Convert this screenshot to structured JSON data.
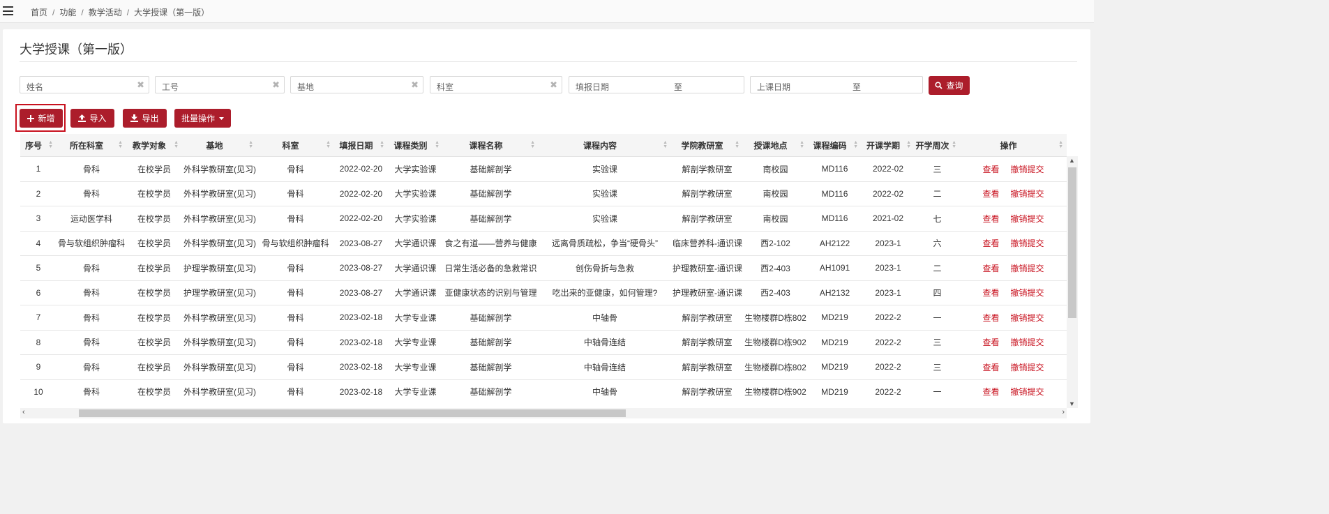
{
  "breadcrumb": [
    "首页",
    "功能",
    "教学活动",
    "大学授课（第一版）"
  ],
  "page": {
    "title": "大学授课（第一版）"
  },
  "filters": {
    "name_ph": "姓名",
    "id_ph": "工号",
    "base_ph": "基地",
    "dept_ph": "科室",
    "fill_date_ph": "填报日期",
    "class_date_ph": "上课日期",
    "to_text": "至",
    "clear_glyph": "✖",
    "search_label": "查询"
  },
  "toolbar": {
    "add_label": "新增",
    "import_label": "导入",
    "export_label": "导出",
    "batch_label": "批量操作"
  },
  "table": {
    "columns": [
      "序号",
      "所在科室",
      "教学对象",
      "基地",
      "科室",
      "填报日期",
      "课程类别",
      "课程名称",
      "课程内容",
      "学院教研室",
      "授课地点",
      "课程编码",
      "开课学期",
      "开学周次",
      "操作"
    ],
    "rows": [
      [
        "1",
        "骨科",
        "在校学员",
        "外科学教研室(见习)",
        "骨科",
        "2022-02-20",
        "大学实验课",
        "基础解剖学",
        "实验课",
        "解剖学教研室",
        "南校园",
        "MD116",
        "2022-02",
        "三"
      ],
      [
        "2",
        "骨科",
        "在校学员",
        "外科学教研室(见习)",
        "骨科",
        "2022-02-20",
        "大学实验课",
        "基础解剖学",
        "实验课",
        "解剖学教研室",
        "南校园",
        "MD116",
        "2022-02",
        "二"
      ],
      [
        "3",
        "运动医学科",
        "在校学员",
        "外科学教研室(见习)",
        "骨科",
        "2022-02-20",
        "大学实验课",
        "基础解剖学",
        "实验课",
        "解剖学教研室",
        "南校园",
        "MD116",
        "2021-02",
        "七"
      ],
      [
        "4",
        "骨与软组织肿瘤科",
        "在校学员",
        "外科学教研室(见习)",
        "骨与软组织肿瘤科",
        "2023-08-27",
        "大学通识课",
        "食之有道——营养与健康",
        "远离骨质疏松，争当“硬骨头”",
        "临床营养科-通识课",
        "西2-102",
        "AH2122",
        "2023-1",
        "六"
      ],
      [
        "5",
        "骨科",
        "在校学员",
        "护理学教研室(见习)",
        "骨科",
        "2023-08-27",
        "大学通识课",
        "日常生活必备的急救常识",
        "创伤骨折与急救",
        "护理教研室-通识课",
        "西2-403",
        "AH1091",
        "2023-1",
        "二"
      ],
      [
        "6",
        "骨科",
        "在校学员",
        "护理学教研室(见习)",
        "骨科",
        "2023-08-27",
        "大学通识课",
        "亚健康状态的识别与管理",
        "吃出来的亚健康，如何管理?",
        "护理教研室-通识课",
        "西2-403",
        "AH2132",
        "2023-1",
        "四"
      ],
      [
        "7",
        "骨科",
        "在校学员",
        "外科学教研室(见习)",
        "骨科",
        "2023-02-18",
        "大学专业课",
        "基础解剖学",
        "中轴骨",
        "解剖学教研室",
        "生物楼群D栋802",
        "MD219",
        "2022-2",
        "一"
      ],
      [
        "8",
        "骨科",
        "在校学员",
        "外科学教研室(见习)",
        "骨科",
        "2023-02-18",
        "大学专业课",
        "基础解剖学",
        "中轴骨连结",
        "解剖学教研室",
        "生物楼群D栋902",
        "MD219",
        "2022-2",
        "三"
      ],
      [
        "9",
        "骨科",
        "在校学员",
        "外科学教研室(见习)",
        "骨科",
        "2023-02-18",
        "大学专业课",
        "基础解剖学",
        "中轴骨连结",
        "解剖学教研室",
        "生物楼群D栋802",
        "MD219",
        "2022-2",
        "三"
      ],
      [
        "10",
        "骨科",
        "在校学员",
        "外科学教研室(见习)",
        "骨科",
        "2023-02-18",
        "大学专业课",
        "基础解剖学",
        "中轴骨",
        "解剖学教研室",
        "生物楼群D栋902",
        "MD219",
        "2022-2",
        "一"
      ]
    ],
    "actions": {
      "view": "查看",
      "revoke": "撤销提交"
    }
  },
  "colors": {
    "accent": "#ac1d2b",
    "action_link": "#c8111e",
    "header_bg": "#f5f5f5"
  }
}
